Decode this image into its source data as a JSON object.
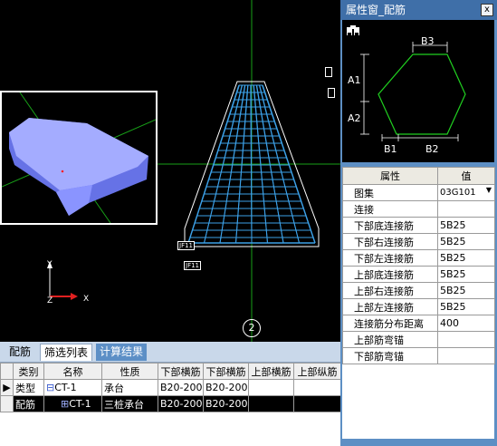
{
  "viewport": {
    "tags": [
      "JF11",
      "JF11"
    ],
    "circle_label": "2",
    "axis": {
      "y": "Y",
      "z": "Z",
      "x": "X"
    },
    "colors": {
      "mesh": "#3ca0e6",
      "axis_green": "#18a018",
      "preview_block": "#9aa6ff"
    }
  },
  "bottom": {
    "tabs": [
      "配筋",
      "筛选列表",
      "计算结果"
    ],
    "table": {
      "headers": [
        "类别",
        "名称",
        "性质",
        "下部横筋",
        "下部横筋",
        "上部横筋",
        "上部纵筋"
      ],
      "rows": [
        {
          "marker": "▶",
          "category": "类型",
          "tree": "⊟",
          "name": "CT-1",
          "nature": "承台",
          "c1": "B20-200",
          "c2": "B20-200",
          "c3": "",
          "c4": ""
        },
        {
          "marker": "",
          "category": "配筋",
          "tree": "⊞",
          "name": "CT-1",
          "nature": "三桩承台",
          "c1": "B20-200",
          "c2": "B20-200",
          "c3": "",
          "c4": ""
        }
      ]
    }
  },
  "property_window": {
    "title": "属性窗_配筋",
    "close": "x",
    "diagram_labels": {
      "b3": "B3",
      "a1": "A1",
      "a2": "A2",
      "b1": "B1",
      "b2": "B2"
    },
    "table_headers": {
      "attr": "属性",
      "value": "值"
    },
    "rows": [
      {
        "label": "图集",
        "value": "03G101"
      },
      {
        "label": "连接",
        "value": ""
      },
      {
        "label": "下部底连接筋",
        "value": "5B25"
      },
      {
        "label": "下部右连接筋",
        "value": "5B25"
      },
      {
        "label": "下部左连接筋",
        "value": "5B25"
      },
      {
        "label": "上部底连接筋",
        "value": "5B25"
      },
      {
        "label": "上部右连接筋",
        "value": "5B25"
      },
      {
        "label": "上部左连接筋",
        "value": "5B25"
      },
      {
        "label": "连接筋分布距离",
        "value": "400"
      },
      {
        "label": "上部筋弯锚",
        "value": ""
      },
      {
        "label": "下部筋弯锚",
        "value": ""
      }
    ]
  }
}
